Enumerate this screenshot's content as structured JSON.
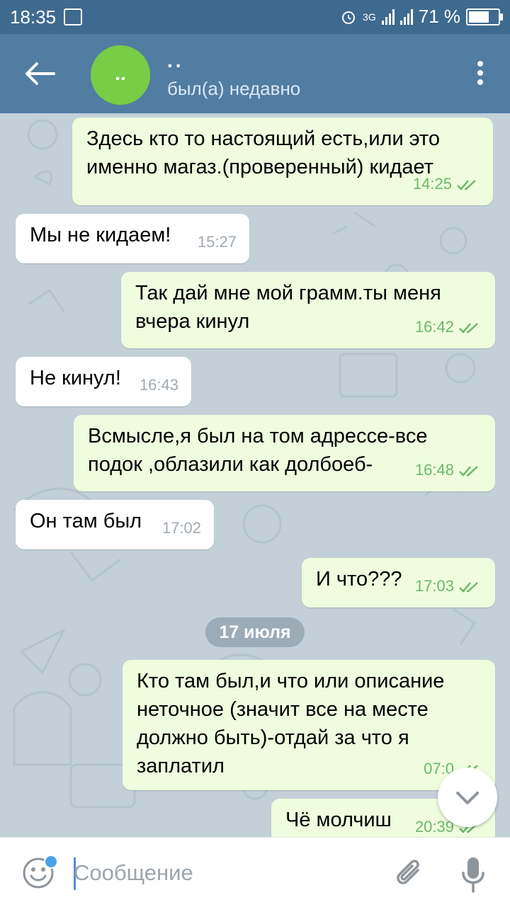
{
  "status_bar": {
    "time": "18:35",
    "network": "3G",
    "battery_text": "71 %",
    "battery_level": 0.71,
    "icons": [
      "gallery-icon",
      "alarm-icon",
      "signal-icon",
      "battery-icon"
    ]
  },
  "header": {
    "avatar_initials": "..",
    "name": "..",
    "status": "был(а) недавно",
    "avatar_color": "#79cc46",
    "bar_color": "#517da2"
  },
  "messages": [
    {
      "text": "Здесь кто то настоящий есть,или это\nименно магаз.(проверенный) кидает",
      "time": "14:25",
      "direction": "out"
    },
    {
      "text": "Мы не кидаем!",
      "time": "15:27",
      "direction": "in"
    },
    {
      "text": "Так дай мне мой грамм.ты меня\nвчера кинул",
      "time": "16:42",
      "direction": "out"
    },
    {
      "text": "Не кинул!",
      "time": "16:43",
      "direction": "in"
    },
    {
      "text": "Всмысле,я был на том адрессе-все\nподок ,облазили как долбоеб-",
      "time": "16:48",
      "direction": "out"
    },
    {
      "text": "Он там был",
      "time": "17:02",
      "direction": "in"
    },
    {
      "text": "И что???",
      "time": "17:03",
      "direction": "out"
    },
    {
      "text": "Кто там был,и что или описание\nнеточное (значит все на месте\nдолжно быть)-отдай за что я\nзаплатил",
      "time": "07:0",
      "direction": "out"
    },
    {
      "text": "Чё молчиш",
      "time": "20:39",
      "direction": "out"
    }
  ],
  "date_divider": "17 июля",
  "input": {
    "placeholder": "Сообщение"
  },
  "colors": {
    "outgoing_bubble": "#effdde",
    "incoming_bubble": "#ffffff",
    "read_ticks": "#6cb86a",
    "chat_background": "#c3d0d8"
  }
}
